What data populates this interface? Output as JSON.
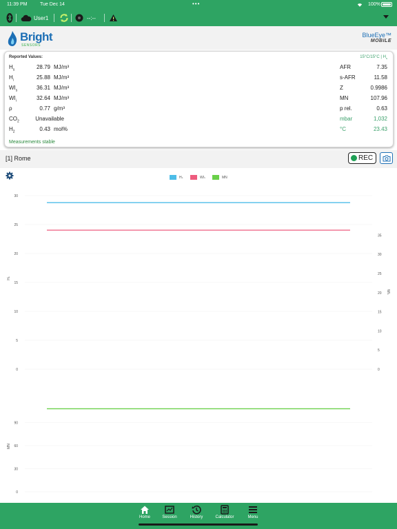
{
  "status_bar": {
    "time": "11:39 PM",
    "date": "Tue Dec 14",
    "dots": "•••",
    "battery": "100%"
  },
  "toolbar": {
    "user": "User1",
    "timer": "--:--"
  },
  "header": {
    "brand": "Bright",
    "brand_sub": "SENSORS",
    "product": "BlueEye™",
    "product_sub": "MOBILE"
  },
  "reported": {
    "title": "Reported Values:",
    "conditions": "15°C/15°C  |  H",
    "left": [
      {
        "label": "H",
        "sub": "s",
        "value": "28.79",
        "unit": "MJ/m³"
      },
      {
        "label": "H",
        "sub": "i",
        "value": "25.88",
        "unit": "MJ/m³"
      },
      {
        "label": "WI",
        "sub": "s",
        "value": "36.31",
        "unit": "MJ/m³"
      },
      {
        "label": "WI",
        "sub": "i",
        "value": "32.64",
        "unit": "MJ/m³"
      },
      {
        "label": "ρ",
        "sub": "",
        "value": "0.77",
        "unit": "g/m³"
      },
      {
        "label": "CO",
        "sub": "2",
        "value": "Unavailable",
        "unit": ""
      },
      {
        "label": "H",
        "sub": "2",
        "value": "0.43",
        "unit": "mol%"
      }
    ],
    "right": [
      {
        "label": "AFR",
        "value": "7.35"
      },
      {
        "label": "s-AFR",
        "value": "11.58"
      },
      {
        "label": "Z",
        "value": "0.9986"
      },
      {
        "label": "MN",
        "value": "107.96"
      },
      {
        "label": "p rel.",
        "value": "0.63"
      },
      {
        "label": "mbar",
        "value": "1,032"
      },
      {
        "label": "°C",
        "value": "23.43"
      }
    ],
    "status": "Measurements stable"
  },
  "session": {
    "location": "[1]  Rome",
    "rec_label": "REC"
  },
  "chart_data": {
    "type": "line",
    "legend": [
      {
        "name": "Hₛ",
        "color": "#4dbde8"
      },
      {
        "name": "WIₛ",
        "color": "#ee5c7e"
      },
      {
        "name": "MN",
        "color": "#6ad04a"
      }
    ],
    "top_panel": {
      "left_axis": {
        "label": "Hₛ",
        "ticks": [
          0,
          5,
          10,
          15,
          20,
          25,
          30
        ],
        "range": [
          0,
          30
        ]
      },
      "right_axis": {
        "label": "WIₛ",
        "ticks": [
          0,
          5,
          10,
          15,
          20,
          25,
          30,
          35
        ],
        "range": [
          0,
          35
        ]
      },
      "series": [
        {
          "name": "Hₛ",
          "axis": "left",
          "y": 28.79,
          "color": "#4dbde8"
        },
        {
          "name": "WIₛ",
          "axis": "right",
          "y": 36.31,
          "color": "#ee5c7e"
        }
      ]
    },
    "bottom_panel": {
      "left_axis": {
        "label": "MN",
        "ticks": [
          0,
          30,
          60,
          90
        ],
        "range": [
          0,
          120
        ]
      },
      "series": [
        {
          "name": "MN",
          "axis": "left",
          "y": 107.96,
          "color": "#6ad04a"
        }
      ]
    }
  },
  "bottom_nav": [
    {
      "label": "Home",
      "icon": "home-icon"
    },
    {
      "label": "Session",
      "icon": "session-icon"
    },
    {
      "label": "History",
      "icon": "history-icon"
    },
    {
      "label": "Calculator",
      "icon": "calculator-icon"
    },
    {
      "label": "Menu",
      "icon": "menu-icon"
    }
  ],
  "colors": {
    "accent_green": "#2ea463",
    "brand_blue": "#1d6fb5"
  }
}
